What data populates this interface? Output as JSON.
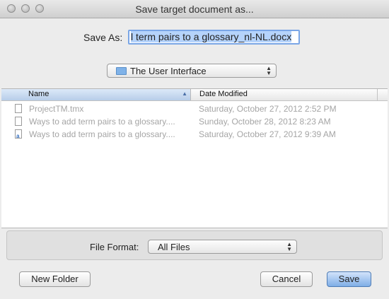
{
  "window": {
    "title": "Save target document as..."
  },
  "save_as": {
    "label": "Save As:",
    "value": "l term pairs to a glossary_nl-NL.docx"
  },
  "location": {
    "label": "The User Interface",
    "icon": "folder-icon"
  },
  "browser": {
    "columns": {
      "name": "Name",
      "date": "Date Modified"
    },
    "sort": "name-ascending",
    "files": [
      {
        "name": "ProjectTM.tmx",
        "date": "Saturday, October 27, 2012 2:52 PM",
        "icon": "document-icon"
      },
      {
        "name": "Ways to add term pairs to a glossary....",
        "date": "Sunday, October 28, 2012 8:23 AM",
        "icon": "document-icon"
      },
      {
        "name": "Ways to add term pairs to a glossary....",
        "date": "Saturday, October 27, 2012 9:39 AM",
        "icon": "word-document-icon"
      }
    ]
  },
  "file_format": {
    "label": "File Format:",
    "value": "All Files"
  },
  "buttons": {
    "new_folder": "New Folder",
    "cancel": "Cancel",
    "save": "Save"
  },
  "colors": {
    "default_button": "#7faee6",
    "selection_highlight": "#b5d3fb",
    "disabled_text": "#a5a5a5"
  }
}
